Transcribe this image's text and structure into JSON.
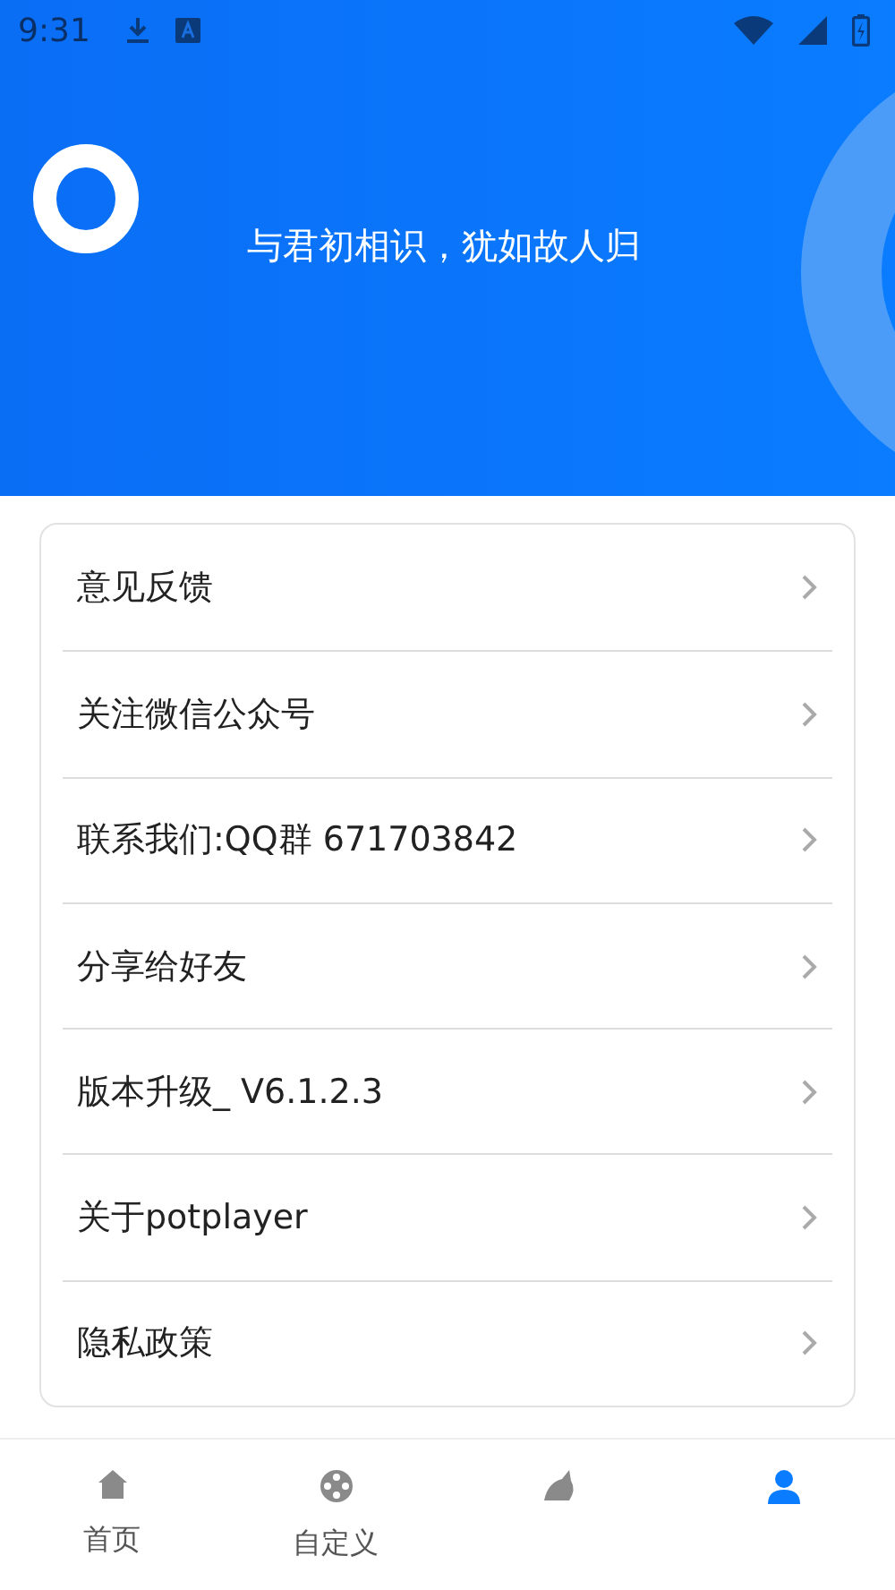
{
  "status_bar": {
    "time": "9:31"
  },
  "header": {
    "slogan": "与君初相识，犹如故人归"
  },
  "menu": [
    {
      "label": "意见反馈"
    },
    {
      "label": "关注微信公众号"
    },
    {
      "label": "联系我们:QQ群 671703842"
    },
    {
      "label": "分享给好友"
    },
    {
      "label": "版本升级_ V6.1.2.3"
    },
    {
      "label": "关于potplayer"
    },
    {
      "label": "隐私政策"
    }
  ],
  "tabs": [
    {
      "kind": "home",
      "label": "首页",
      "selected": false
    },
    {
      "kind": "film",
      "label": "自定义",
      "selected": false
    },
    {
      "kind": "bird",
      "selected": false
    },
    {
      "kind": "person",
      "selected": true
    }
  ]
}
